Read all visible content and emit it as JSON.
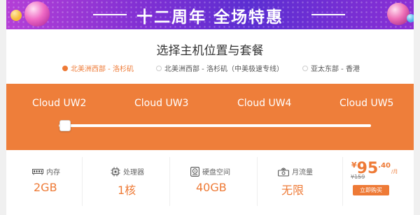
{
  "banner": {
    "title": "十二周年 全场特惠"
  },
  "page_title": "选择主机位置与套餐",
  "regions": [
    {
      "label": "北美洲西部 - 洛杉矶",
      "selected": true
    },
    {
      "label": "北美洲西部 - 洛杉矶（中美极速专线）",
      "selected": false
    },
    {
      "label": "亚太东部 - 香港",
      "selected": false
    }
  ],
  "plans": [
    "Cloud UW2",
    "Cloud UW3",
    "Cloud UW4",
    "Cloud UW5"
  ],
  "selected_plan": "Cloud UW2",
  "specs": {
    "memory": {
      "label": "内存",
      "value": "2GB",
      "icon": "memory-icon"
    },
    "cpu": {
      "label": "处理器",
      "value": "1核",
      "icon": "cpu-icon"
    },
    "disk": {
      "label": "硬盘空间",
      "value": "40GB",
      "icon": "disk-icon"
    },
    "traffic": {
      "label": "月流量",
      "value": "无限",
      "icon": "traffic-icon"
    }
  },
  "price": {
    "symbol": "¥",
    "integer": "95",
    "decimal": ".40",
    "unit": "/月",
    "old": "¥159",
    "buy_label": "立即购买"
  },
  "colors": {
    "accent": "#ee7a36",
    "banner": "#6a2fd3"
  }
}
